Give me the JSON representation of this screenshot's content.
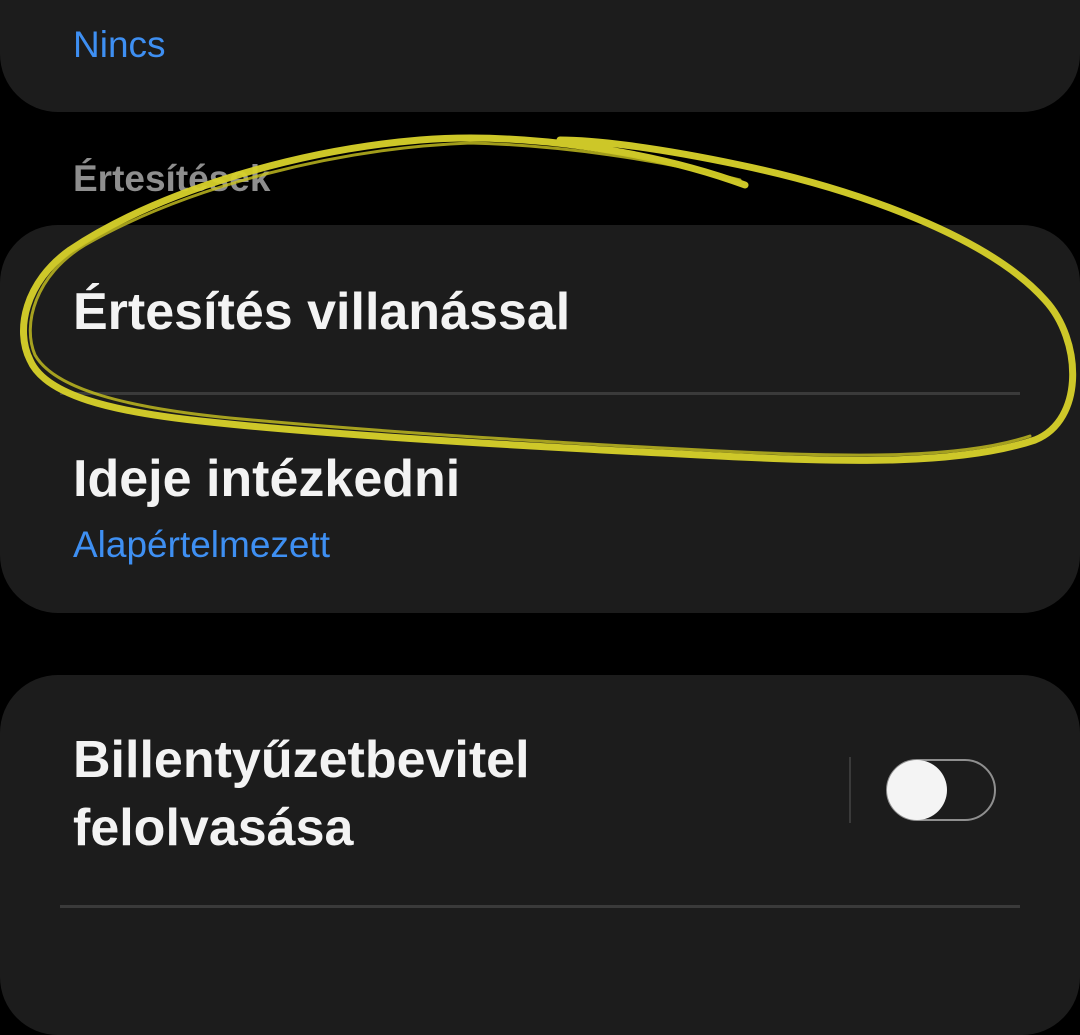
{
  "top_item": {
    "subtitle": "Nincs"
  },
  "notifications_section": {
    "header": "Értesítések",
    "items": [
      {
        "title": "Értesítés villanással"
      },
      {
        "title": "Ideje intézkedni",
        "subtitle": "Alapértelmezett"
      }
    ]
  },
  "keyboard_item": {
    "title_line1": "Billentyűzetbevitel",
    "title_line2": "felolvasása",
    "toggle_on": false
  },
  "colors": {
    "background": "#000000",
    "card": "#1c1c1c",
    "accent_blue": "#3e8ff2",
    "annotation_yellow": "#d8d22a",
    "header_grey": "#8e8e8e"
  }
}
